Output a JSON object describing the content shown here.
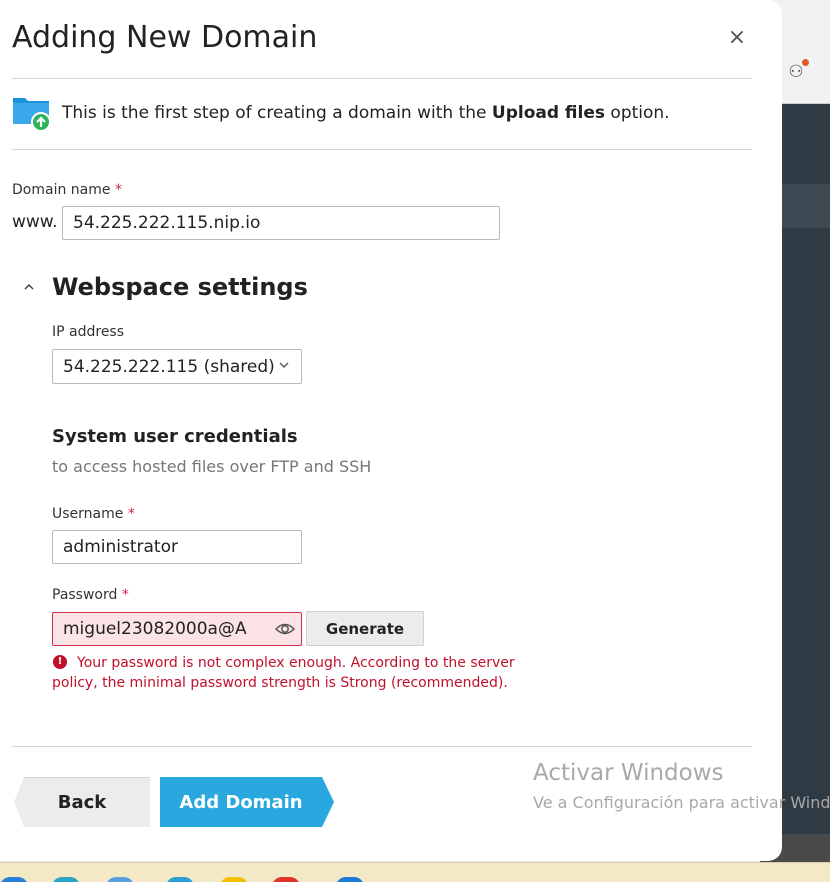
{
  "dialog": {
    "title": "Adding New Domain",
    "close_symbol": "×",
    "intro_prefix": "This is the first step of creating a domain with the ",
    "intro_bold": "Upload files",
    "intro_suffix": " option.",
    "intro_icon": "folder-upload-icon"
  },
  "domain": {
    "label": "Domain name",
    "required_mark": "*",
    "prefix": "www.",
    "value": "54.225.222.115.nip.io"
  },
  "webspace": {
    "toggle_symbol": "^",
    "title": "Webspace settings",
    "ip_label": "IP address",
    "ip_value": "54.225.222.115 (shared)",
    "credentials_title": "System user credentials",
    "credentials_desc": "to access hosted files over FTP and SSH",
    "username_label": "Username",
    "username_value": "administrator",
    "password_label": "Password",
    "password_value": "miguel23082000a@A",
    "generate_label": "Generate",
    "error_symbol": "!",
    "error_text": "Your password is not complex enough. According to the server policy, the minimal password strength is Strong (recommended)."
  },
  "footer": {
    "back_label": "Back",
    "add_label": "Add Domain"
  },
  "watermark": {
    "title": "Activar Windows",
    "subtitle": "Ve a Configuración para activar Windo"
  },
  "colors": {
    "primary": "#28a8de",
    "error": "#c0102c",
    "required": "#d02a44"
  }
}
